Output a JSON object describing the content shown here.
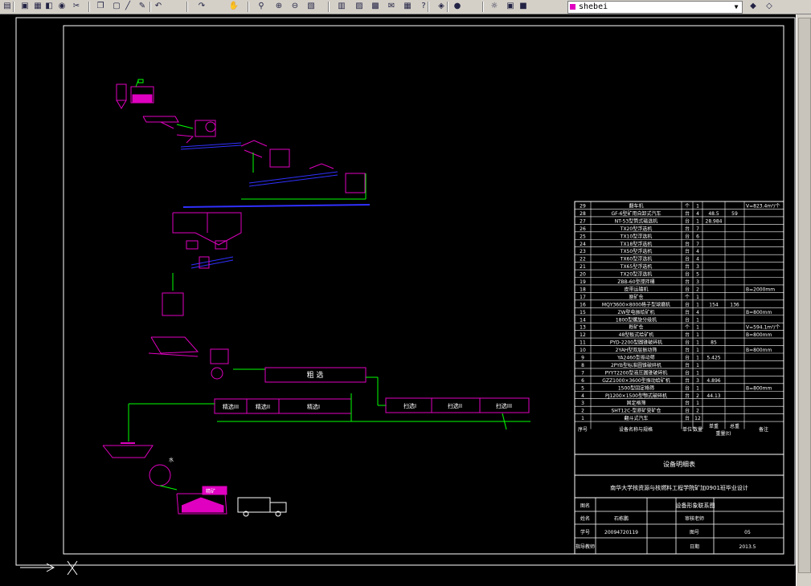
{
  "toolbar": {
    "layer_name": "shebei",
    "layer_color": "#e000c0",
    "icons": [
      "open-icon",
      "save-icon",
      "print-icon",
      "plot-icon",
      "publish-icon",
      "cut-icon",
      "copy-icon",
      "paste-icon",
      "match-icon",
      "brush-icon",
      "undo-icon",
      "redo-icon",
      "pan-icon",
      "zoom-realtime-icon",
      "zoom-window-icon",
      "zoom-previous-icon",
      "properties-icon",
      "designcenter-icon",
      "toolpalette-icon",
      "sheetset-icon",
      "markup-icon",
      "calculator-icon",
      "help-icon",
      "layer-manager-icon",
      "bulb-icon",
      "sun-icon",
      "lock-icon",
      "color-icon",
      "layer-prev-icon",
      "layer-state-icon"
    ]
  },
  "colors": {
    "equipment": "#e000c0",
    "flow": "#00ff00",
    "blue": "#3030ff",
    "white": "#ffffff",
    "background": "#000000"
  },
  "process": {
    "rougher": "粗 选",
    "cleaner3": "精选III",
    "cleaner2": "精选II",
    "cleaner1": "精选I",
    "scav1": "扫选I",
    "scav2": "扫选II",
    "scav3": "扫选III",
    "concentrate": "精矿",
    "water": "水"
  },
  "equipment_table": {
    "rows": [
      {
        "no": "29",
        "name": "翻车机",
        "unit": "个",
        "qty": "1",
        "w1": "",
        "w2": "",
        "note": "V=823.4m³/个"
      },
      {
        "no": "28",
        "name": "GF-6型矿用自卸式汽车",
        "unit": "台",
        "qty": "4",
        "w1": "48.5",
        "w2": "59",
        "note": ""
      },
      {
        "no": "27",
        "name": "NT-53型筒式磁选机",
        "unit": "台",
        "qty": "1",
        "w1": "28.984",
        "w2": "",
        "note": ""
      },
      {
        "no": "26",
        "name": "TX20型浮选机",
        "unit": "台",
        "qty": "7",
        "w1": "",
        "w2": "",
        "note": ""
      },
      {
        "no": "25",
        "name": "TX10型浮选机",
        "unit": "台",
        "qty": "6",
        "w1": "",
        "w2": "",
        "note": ""
      },
      {
        "no": "24",
        "name": "TX18型浮选机",
        "unit": "台",
        "qty": "7",
        "w1": "",
        "w2": "",
        "note": ""
      },
      {
        "no": "23",
        "name": "TX50型浮选机",
        "unit": "台",
        "qty": "4",
        "w1": "",
        "w2": "",
        "note": ""
      },
      {
        "no": "22",
        "name": "TX60型浮选机",
        "unit": "台",
        "qty": "4",
        "w1": "",
        "w2": "",
        "note": ""
      },
      {
        "no": "21",
        "name": "TX65型浮选机",
        "unit": "台",
        "qty": "3",
        "w1": "",
        "w2": "",
        "note": ""
      },
      {
        "no": "20",
        "name": "TX20型浮选机",
        "unit": "台",
        "qty": "5",
        "w1": "",
        "w2": "",
        "note": ""
      },
      {
        "no": "19",
        "name": "ZBB-60型搅拌桶",
        "unit": "台",
        "qty": "3",
        "w1": "",
        "w2": "",
        "note": ""
      },
      {
        "no": "18",
        "name": "皮带运输机",
        "unit": "台",
        "qty": "2",
        "w1": "",
        "w2": "",
        "note": "B=2000mm"
      },
      {
        "no": "17",
        "name": "原矿仓",
        "unit": "个",
        "qty": "1",
        "w1": "",
        "w2": "",
        "note": ""
      },
      {
        "no": "16",
        "name": "MQY3600×8000格子型球磨机",
        "unit": "台",
        "qty": "1",
        "w1": "154",
        "w2": "136",
        "note": ""
      },
      {
        "no": "15",
        "name": "ZW型电振给矿机",
        "unit": "台",
        "qty": "4",
        "w1": "",
        "w2": "",
        "note": "B=800mm"
      },
      {
        "no": "14",
        "name": "1800型螺旋分级机",
        "unit": "台",
        "qty": "1",
        "w1": "",
        "w2": "",
        "note": ""
      },
      {
        "no": "13",
        "name": "粉矿仓",
        "unit": "个",
        "qty": "1",
        "w1": "",
        "w2": "",
        "note": "V=594.1m³/个"
      },
      {
        "no": "12",
        "name": "48型板式给矿机",
        "unit": "台",
        "qty": "1",
        "w1": "",
        "w2": "",
        "note": "B=800mm"
      },
      {
        "no": "11",
        "name": "PYD-2200型圆锥破碎机",
        "unit": "台",
        "qty": "1",
        "w1": "85",
        "w2": "",
        "note": ""
      },
      {
        "no": "10",
        "name": "2YAH型双层振动筛",
        "unit": "台",
        "qty": "1",
        "w1": "",
        "w2": "",
        "note": "B=800mm"
      },
      {
        "no": "9",
        "name": "YA2460型振动筛",
        "unit": "台",
        "qty": "1",
        "w1": "5.425",
        "w2": "",
        "note": ""
      },
      {
        "no": "8",
        "name": "2PYB型标准圆锥破碎机",
        "unit": "台",
        "qty": "1",
        "w1": "",
        "w2": "",
        "note": ""
      },
      {
        "no": "7",
        "name": "PYYT2200型液压圆锥破碎机",
        "unit": "台",
        "qty": "1",
        "w1": "",
        "w2": "",
        "note": ""
      },
      {
        "no": "6",
        "name": "GZZ1000×3600型振动给矿机",
        "unit": "台",
        "qty": "3",
        "w1": "4.896",
        "w2": "",
        "note": ""
      },
      {
        "no": "5",
        "name": "1500型固定格筛",
        "unit": "台",
        "qty": "1",
        "w1": "",
        "w2": "",
        "note": "B=800mm"
      },
      {
        "no": "4",
        "name": "PJ1200×1500型颚式破碎机",
        "unit": "台",
        "qty": "2",
        "w1": "44.13",
        "w2": "",
        "note": ""
      },
      {
        "no": "3",
        "name": "固定格筛",
        "unit": "台",
        "qty": "1",
        "w1": "",
        "w2": "",
        "note": ""
      },
      {
        "no": "2",
        "name": "SHT12C-型原矿受矿仓",
        "unit": "台",
        "qty": "2",
        "w1": "",
        "w2": "",
        "note": ""
      },
      {
        "no": "1",
        "name": "翻斗式汽车",
        "unit": "台",
        "qty": "12",
        "w1": "",
        "w2": "",
        "note": ""
      }
    ],
    "header": {
      "no": "序号",
      "name": "设备名称与规格",
      "unit": "单位",
      "qty": "数量",
      "w1": "单重",
      "w2": "总重",
      "weight": "重量(t)",
      "note": "备注"
    },
    "list_title": "设备明细表",
    "school_title": "南华大学核资源与核燃料工程学院矿加0901班毕业设计",
    "drawing_label": "图名",
    "drawing_name": "设备形象联系图",
    "name_label": "姓名",
    "name_value": "石栋鹏",
    "advisor_label": "审核老师",
    "advisor_value": "",
    "id_label": "学号",
    "id_value": "20094720119",
    "fig_label": "图号",
    "fig_value": "05",
    "teacher_label": "指导教师",
    "date_label": "日期",
    "date_value": "2013.5"
  }
}
